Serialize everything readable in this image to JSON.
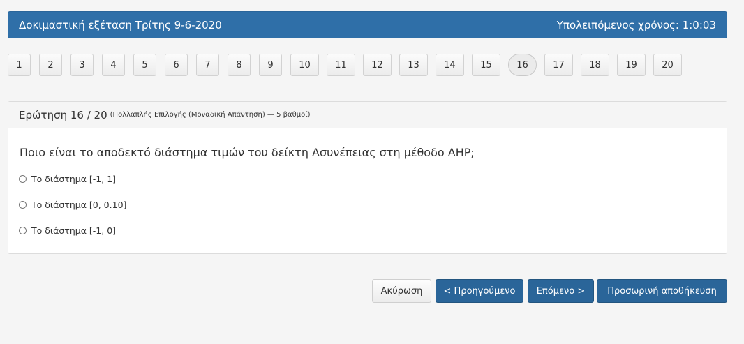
{
  "header": {
    "title": "Δοκιμαστική εξέταση Τρίτης 9-6-2020",
    "time_remaining": "Υπολειπόμενος χρόνος: 1:0:03"
  },
  "navigation": {
    "questions": [
      "1",
      "2",
      "3",
      "4",
      "5",
      "6",
      "7",
      "8",
      "9",
      "10",
      "11",
      "12",
      "13",
      "14",
      "15",
      "16",
      "17",
      "18",
      "19",
      "20"
    ],
    "current": "16"
  },
  "question": {
    "heading": "Ερώτηση 16 / 20",
    "meta": "(Πολλαπλής Επιλογής (Μοναδική Απάντηση) — 5 βαθμοί)",
    "text": "Ποιο είναι το αποδεκτό διάστημα τιμών του δείκτη Ασυνέπειας στη μέθοδο AHP;",
    "options": [
      "Το διάστημα [-1, 1]",
      "Το διάστημα [0, 0.10]",
      "Το διάστημα [-1, 0]"
    ]
  },
  "actions": {
    "cancel": "Ακύρωση",
    "previous": "< Προηγούμενο",
    "next": "Επόμενο >",
    "save": "Προσωρινή αποθήκευση"
  },
  "colors": {
    "header_bg": "#2f6fa8",
    "primary_button": "#2a6599",
    "page_bg": "#f5f5f5"
  }
}
